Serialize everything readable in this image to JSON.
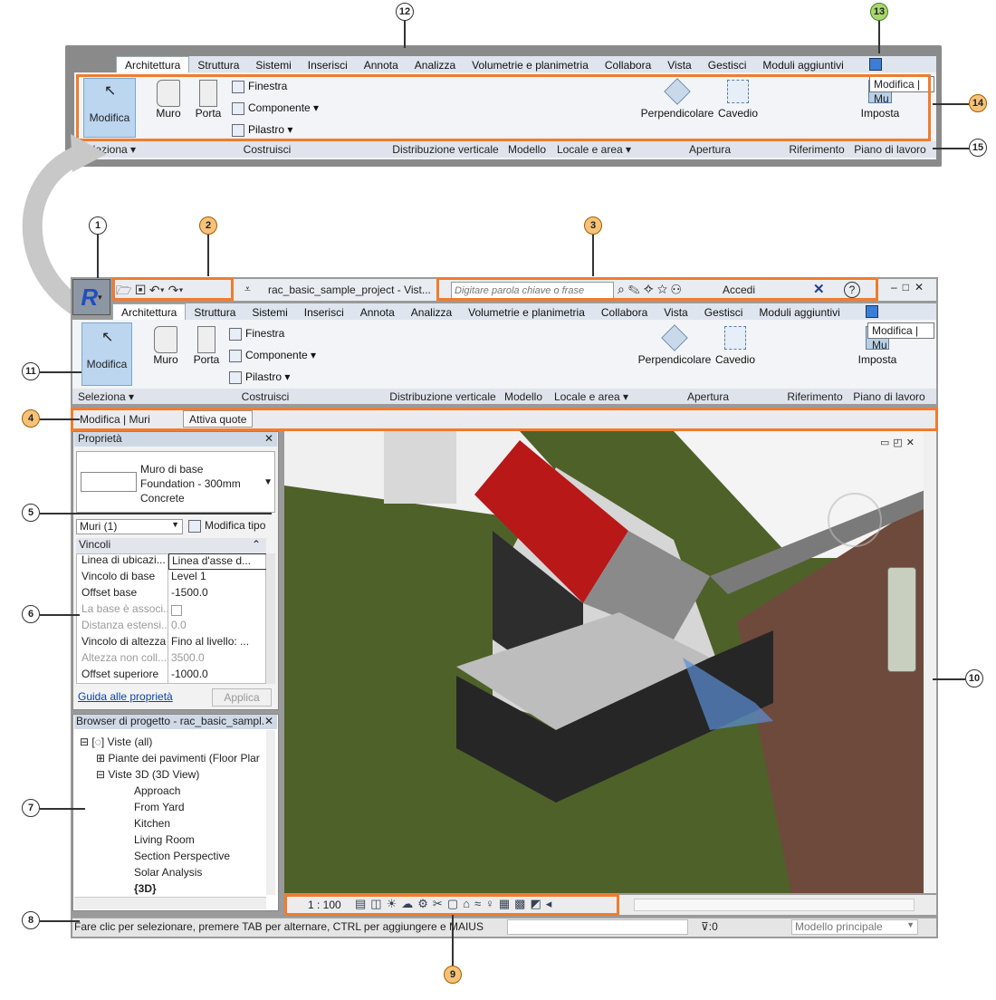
{
  "callouts": [
    "1",
    "2",
    "3",
    "4",
    "5",
    "6",
    "7",
    "8",
    "9",
    "10",
    "11",
    "12",
    "13",
    "14",
    "15"
  ],
  "ribbon": {
    "tabs": [
      "Architettura",
      "Struttura",
      "Sistemi",
      "Inserisci",
      "Annota",
      "Analizza",
      "Volumetrie e planimetria",
      "Collabora",
      "Vista",
      "Gestisci",
      "Moduli aggiuntivi"
    ],
    "tools": {
      "modifica": "Modifica",
      "muro": "Muro",
      "porta": "Porta",
      "finestra": "Finestra",
      "componente": "Componente",
      "pilastro": "Pilastro",
      "perpendicolare": "Perpendicolare",
      "cavedio": "Cavedio",
      "imposta": "Imposta"
    },
    "panels": [
      "Seleziona",
      "Costruisci",
      "Distribuzione verticale",
      "Modello",
      "Locale e area",
      "Apertura",
      "Riferimento",
      "Piano di lavoro"
    ],
    "context_tip": "Modifica | Mu"
  },
  "titlebar": {
    "file": "rac_basic_sample_project - Vist...",
    "search_placeholder": "Digitare parola chiave o frase",
    "signin": "Accedi"
  },
  "options_bar": {
    "context": "Modifica | Muri",
    "button": "Attiva quote"
  },
  "properties": {
    "title": "Proprietà",
    "type_lines": [
      "Muro di base",
      "Foundation - 300mm",
      "Concrete"
    ],
    "filter": "Muri (1)",
    "edit_type": "Modifica tipo",
    "group": "Vincoli",
    "rows": [
      {
        "k": "Linea di ubicazi...",
        "v": "Linea d'asse d..."
      },
      {
        "k": "Vincolo di base",
        "v": "Level 1"
      },
      {
        "k": "Offset base",
        "v": "-1500.0"
      },
      {
        "k": "La base è associ...",
        "v": ""
      },
      {
        "k": "Distanza estensi...",
        "v": "0.0"
      },
      {
        "k": "Vincolo di altezza",
        "v": "Fino al livello: ..."
      },
      {
        "k": "Altezza non coll...",
        "v": "3500.0"
      },
      {
        "k": "Offset superiore",
        "v": "-1000.0"
      }
    ],
    "help": "Guida alle proprietà",
    "apply": "Applica"
  },
  "browser": {
    "title": "Browser di progetto - rac_basic_sampl...",
    "items": [
      "Viste (all)",
      "Piante dei pavimenti (Floor Plar",
      "Viste 3D (3D View)",
      "Approach",
      "From Yard",
      "Kitchen",
      "Living Room",
      "Section Perspective",
      "Solar Analysis",
      "{3D}"
    ]
  },
  "view": {
    "scale": "1 : 100"
  },
  "status": {
    "text": "Fare clic per selezionare, premere TAB per alternare, CTRL per aggiungere e MAIUSC",
    "count": ":0",
    "model": "Modello principale"
  }
}
